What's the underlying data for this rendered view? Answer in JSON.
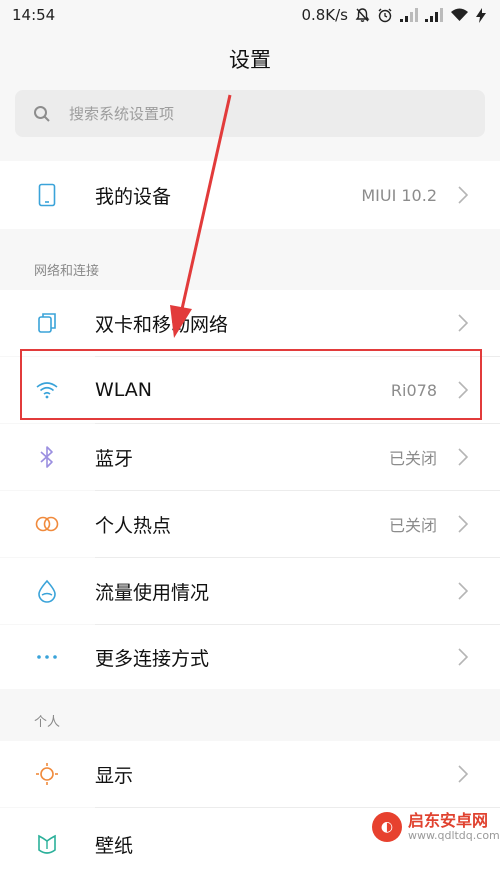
{
  "status_bar": {
    "time": "14:54",
    "speed": "0.8K/s"
  },
  "header": {
    "title": "设置"
  },
  "search": {
    "placeholder": "搜索系统设置项"
  },
  "device": {
    "label": "我的设备",
    "value": "MIUI 10.2"
  },
  "sections": {
    "network": {
      "header": "网络和连接",
      "items": [
        {
          "label": "双卡和移动网络",
          "value": "",
          "icon": "dual-sim-icon"
        },
        {
          "label": "WLAN",
          "value": "Ri078",
          "icon": "wifi-icon"
        },
        {
          "label": "蓝牙",
          "value": "已关闭",
          "icon": "bluetooth-icon"
        },
        {
          "label": "个人热点",
          "value": "已关闭",
          "icon": "hotspot-icon"
        },
        {
          "label": "流量使用情况",
          "value": "",
          "icon": "data-usage-icon"
        },
        {
          "label": "更多连接方式",
          "value": "",
          "icon": "more-icon"
        }
      ]
    },
    "personal": {
      "header": "个人",
      "items": [
        {
          "label": "显示",
          "value": "",
          "icon": "display-icon"
        },
        {
          "label": "壁纸",
          "value": "",
          "icon": "wallpaper-icon"
        }
      ]
    }
  },
  "watermark": {
    "name": "启东安卓网",
    "url": "www.qdltdq.com"
  },
  "colors": {
    "background": "#f7f7f7",
    "annotation": "#e23b3b",
    "icon_blue": "#3aa3d9",
    "icon_orange": "#f08a3c",
    "icon_purple": "#9b8fe0"
  }
}
